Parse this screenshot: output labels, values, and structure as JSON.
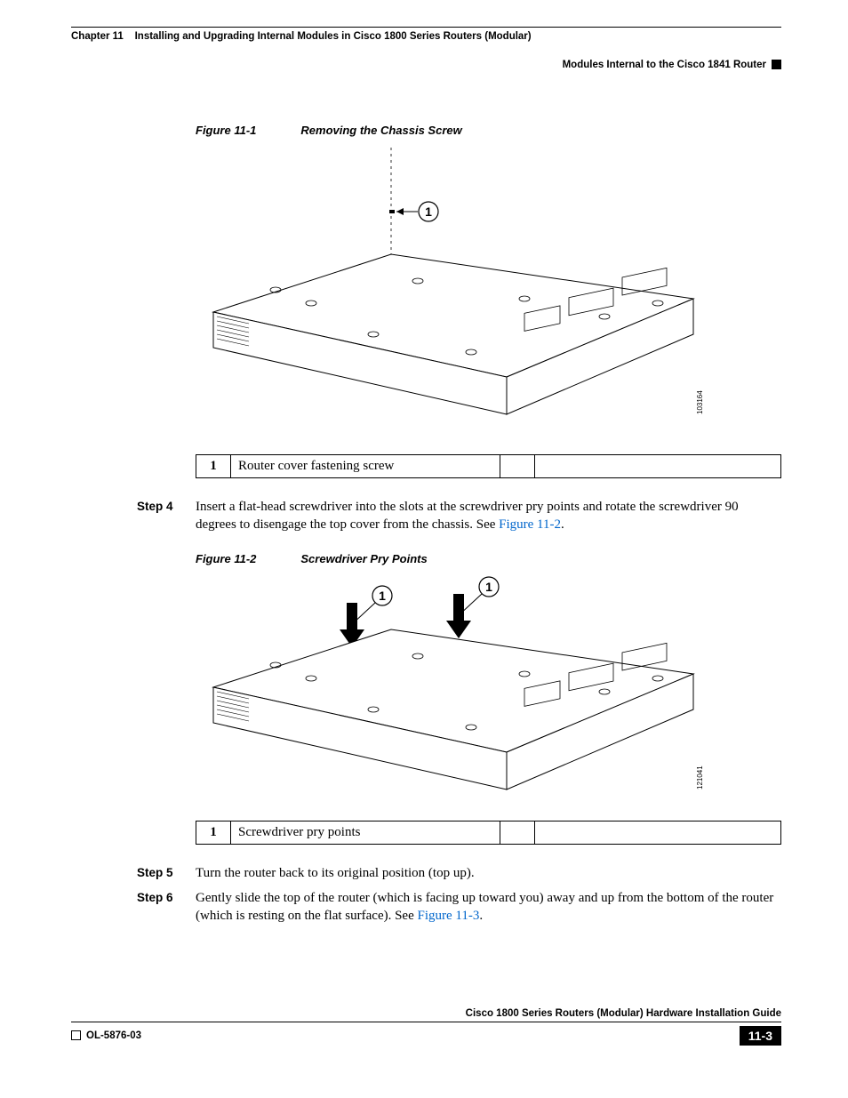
{
  "header": {
    "chapter_label": "Chapter 11",
    "chapter_title": "Installing and Upgrading Internal Modules in Cisco 1800 Series Routers (Modular)",
    "section_title": "Modules Internal to the Cisco 1841 Router"
  },
  "figure1": {
    "number": "Figure 11-1",
    "title": "Removing the Chassis Screw",
    "callout_label": "1",
    "partnum": "103164",
    "table": {
      "num": "1",
      "desc": "Router cover fastening screw"
    }
  },
  "step4": {
    "label": "Step 4",
    "text_before": "Insert a flat-head screwdriver into the slots at the screwdriver pry points and rotate the screwdriver 90 degrees to disengage the top cover from the chassis. See ",
    "link": "Figure 11-2",
    "text_after": "."
  },
  "figure2": {
    "number": "Figure 11-2",
    "title": "Screwdriver Pry Points",
    "callout_label_a": "1",
    "callout_label_b": "1",
    "partnum": "121041",
    "table": {
      "num": "1",
      "desc": "Screwdriver pry points"
    }
  },
  "step5": {
    "label": "Step 5",
    "text": "Turn the router back to its original position (top up)."
  },
  "step6": {
    "label": "Step 6",
    "text_before": "Gently slide the top of the router (which is facing up toward you) away and up from the bottom of the router (which is resting on the flat surface). See ",
    "link": "Figure 11-3",
    "text_after": "."
  },
  "footer": {
    "guide": "Cisco 1800 Series Routers (Modular) Hardware Installation Guide",
    "docnum": "OL-5876-03",
    "pagenum": "11-3"
  }
}
